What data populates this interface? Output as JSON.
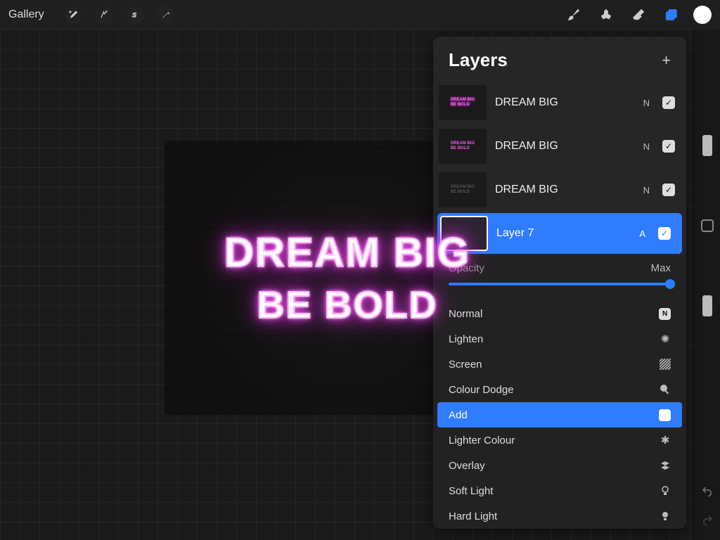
{
  "toolbar": {
    "gallery": "Gallery"
  },
  "canvas": {
    "line1": "DREAM BIG",
    "line2": "BE BOLD"
  },
  "panel": {
    "title": "Layers",
    "layers": [
      {
        "name": "DREAM BIG",
        "blend": "N"
      },
      {
        "name": "DREAM BIG",
        "blend": "N"
      },
      {
        "name": "DREAM BIG",
        "blend": "N"
      },
      {
        "name": "Layer 7",
        "blend": "A"
      }
    ],
    "opacity": {
      "label": "Opacity",
      "value": "Max"
    },
    "blend_modes": [
      {
        "label": "Normal",
        "icon": "badge-n"
      },
      {
        "label": "Lighten",
        "icon": "sparkle"
      },
      {
        "label": "Screen",
        "icon": "hatch"
      },
      {
        "label": "Colour Dodge",
        "icon": "bulb"
      },
      {
        "label": "Add",
        "icon": "badge-plus",
        "selected": true
      },
      {
        "label": "Lighter Colour",
        "icon": "asterisk"
      },
      {
        "label": "Overlay",
        "icon": "layers"
      },
      {
        "label": "Soft Light",
        "icon": "bulb-soft"
      },
      {
        "label": "Hard Light",
        "icon": "bulb-hard"
      }
    ]
  }
}
